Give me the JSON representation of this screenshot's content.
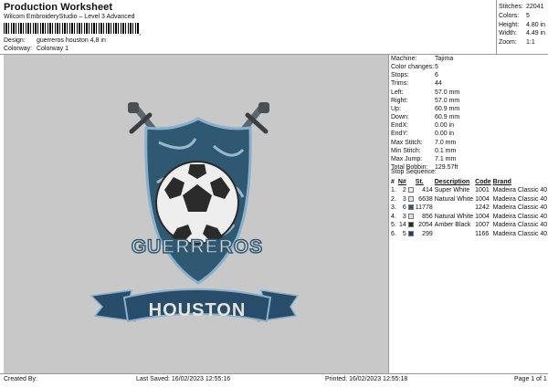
{
  "header": {
    "title": "Production Worksheet",
    "subtitle": "Wilcom EmbroideryStudio – Level 3 Advanced",
    "barcode_tail": ","
  },
  "meta": {
    "design_label": "Design:",
    "design_value": "guerreros houston 4,8 in",
    "colorway_label": "Colorway:",
    "colorway_value": "Colorway 1"
  },
  "stats": [
    {
      "label": "Stitches:",
      "value": "22041"
    },
    {
      "label": "Colors:",
      "value": "5"
    },
    {
      "label": "Height:",
      "value": "4.80 in"
    },
    {
      "label": "Width:",
      "value": "4.49 in"
    },
    {
      "label": "Zoom:",
      "value": "1:1"
    }
  ],
  "design_text": {
    "crest_text": "GUERREROS",
    "banner_text": "HOUSTON"
  },
  "machine": [
    {
      "label": "Machine:",
      "value": "Tajima"
    },
    {
      "label": "Color changes:",
      "value": "5"
    },
    {
      "label": "Stops:",
      "value": "6"
    },
    {
      "label": "Trims:",
      "value": "44"
    },
    {
      "label": "Left:",
      "value": "57.0 mm"
    },
    {
      "label": "Right:",
      "value": "57.0 mm"
    },
    {
      "label": "Up:",
      "value": "60.9 mm"
    },
    {
      "label": "Down:",
      "value": "60.9 mm"
    },
    {
      "label": "EndX:",
      "value": "0.00 in"
    },
    {
      "label": "EndY:",
      "value": "0.00 in"
    },
    {
      "label": "Max Stitch:",
      "value": "7.0 mm"
    },
    {
      "label": "Min Stitch:",
      "value": "0.1 mm"
    },
    {
      "label": "Max Jump:",
      "value": "7.1 mm"
    },
    {
      "label": "Total Bobbin:",
      "value": "129.57ft"
    }
  ],
  "stop_sequence": {
    "heading": "Stop Sequence:",
    "columns": [
      "#",
      "N#",
      "",
      "St.",
      "Description",
      "Code",
      "Brand"
    ],
    "rows": [
      {
        "idx": "1.",
        "n": "2",
        "color": "#f4f4f4",
        "st": "414",
        "desc": "Super White",
        "code": "1001",
        "brand": "Madeira Classic 40"
      },
      {
        "idx": "2.",
        "n": "3",
        "color": "#e6e3d8",
        "st": "6638",
        "desc": "Natural White",
        "code": "1004",
        "brand": "Madeira Classic 40"
      },
      {
        "idx": "3.",
        "n": "6",
        "color": "#2f5872",
        "st": "11778",
        "desc": "",
        "code": "1242",
        "brand": "Madeira Classic 40"
      },
      {
        "idx": "4.",
        "n": "3",
        "color": "#e6e3d8",
        "st": "856",
        "desc": "Natural White",
        "code": "1004",
        "brand": "Madeira Classic 40"
      },
      {
        "idx": "5.",
        "n": "14",
        "color": "#2a2a2a",
        "st": "2054",
        "desc": "Amber Black",
        "code": "1007",
        "brand": "Madeira Classic 40"
      },
      {
        "idx": "6.",
        "n": "5",
        "color": "#1d3e78",
        "st": "299",
        "desc": "",
        "code": "1166",
        "brand": "Madeira Classic 40"
      }
    ]
  },
  "footer": {
    "created_by": "Created By:",
    "last_saved": "Last Saved: 16/02/2023 12:55:16",
    "printed": "Printed: 16/02/2023 12:55:18",
    "page": "Page 1 of 1"
  },
  "colors": {
    "canvas_bg": "#c8c8c8",
    "crest_blue": "#2f5872",
    "banner_blue": "#274d6a",
    "outline_light": "#8ab0cc"
  }
}
